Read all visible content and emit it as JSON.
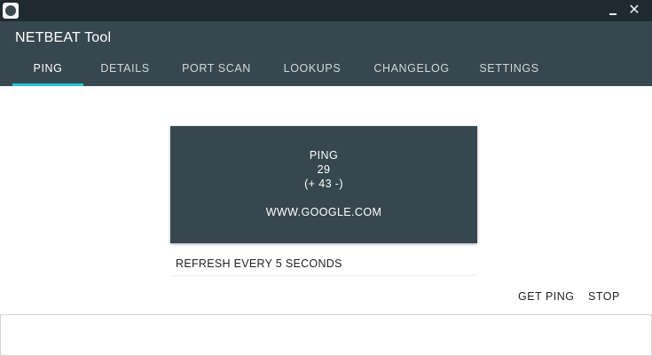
{
  "window": {
    "app_title": "NETBEAT Tool",
    "minimize_glyph": "",
    "close_glyph": "✕"
  },
  "tabs": [
    {
      "label": "PING",
      "active": true
    },
    {
      "label": "DETAILS",
      "active": false
    },
    {
      "label": "PORT SCAN",
      "active": false
    },
    {
      "label": "LOOKUPS",
      "active": false
    },
    {
      "label": "CHANGELOG",
      "active": false
    },
    {
      "label": "SETTINGS",
      "active": false
    }
  ],
  "ping": {
    "title": "PING",
    "value": "29",
    "delta": "(+ 43 -)",
    "host": "WWW.GOOGLE.COM"
  },
  "refresh": {
    "label": "REFRESH EVERY 5 SECONDS"
  },
  "actions": {
    "get_ping": "GET PING",
    "stop": "STOP"
  },
  "colors": {
    "titlebar": "#1f2a30",
    "header": "#37474f",
    "tab_indicator": "#26c6da",
    "card": "#37474f"
  },
  "icons": {
    "app": "app-logo-icon",
    "minimize": "minimize-icon",
    "close": "close-icon"
  }
}
